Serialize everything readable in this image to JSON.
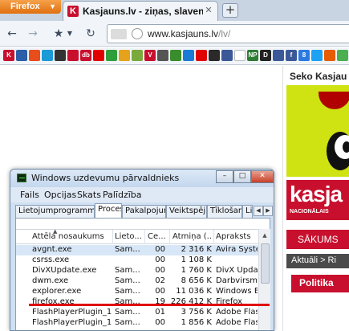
{
  "browser": {
    "menu_button": "Firefox",
    "tab": {
      "title": "Kasjauns.lv - ziņas, slavenības, sports, i...",
      "favicon_letter": "K"
    },
    "new_tab": "+",
    "url": {
      "domain": "www.kasjauns.lv",
      "path": "/lv/"
    }
  },
  "bookmarks": [
    {
      "label": "K",
      "color": "#c8102e"
    },
    {
      "label": "",
      "color": "#2b5fa8"
    },
    {
      "label": "",
      "color": "#e84d1c"
    },
    {
      "label": "",
      "color": "#1a9ad6"
    },
    {
      "label": "",
      "color": "#333333"
    },
    {
      "label": "",
      "color": "#c8102e"
    },
    {
      "label": "db",
      "color": "#c8102e"
    },
    {
      "label": "",
      "color": "#e00000"
    },
    {
      "label": "",
      "color": "#2e9e3a"
    },
    {
      "label": "",
      "color": "#e6a21a"
    },
    {
      "label": "",
      "color": "#7aa93c"
    },
    {
      "label": "V",
      "color": "#c8102e"
    },
    {
      "label": "",
      "color": "#555555"
    },
    {
      "label": "",
      "color": "#3a8d2c"
    },
    {
      "label": "",
      "color": "#1a7bd6"
    },
    {
      "label": "",
      "color": "#e00000"
    },
    {
      "label": "",
      "color": "#2a2a2a"
    },
    {
      "label": "",
      "color": "#3b5998"
    },
    {
      "label": "",
      "color": "#ffffff"
    },
    {
      "label": "NP",
      "color": "#2e7d32"
    },
    {
      "label": "D",
      "color": "#222222"
    },
    {
      "label": "",
      "color": "#3b5998"
    },
    {
      "label": "f",
      "color": "#3b5998"
    },
    {
      "label": "8",
      "color": "#2a7ae2"
    },
    {
      "label": "",
      "color": "#1da1f2"
    },
    {
      "label": "",
      "color": "#e65c00"
    },
    {
      "label": "",
      "color": "#4caf50"
    }
  ],
  "page": {
    "seko": "Seko Kasjau",
    "logo_text": "kasja",
    "logo_sub": "NACIONĀLAIS",
    "nav_home": "SĀKUMS",
    "nav_bar": "Aktuāli >   Ri",
    "section": "Politika"
  },
  "taskmanager": {
    "title": "Windows uzdevumu pārvaldnieks",
    "window_buttons": {
      "min": "–",
      "max": "□",
      "close": "✕"
    },
    "menu": [
      "Fails",
      "Opcijas",
      "Skats",
      "Palīdzība"
    ],
    "tabs": [
      "Lietojumprogrammas",
      "Procesi",
      "Pakalpojumi",
      "Veiktspēja",
      "Tīklošana",
      "Li"
    ],
    "active_tab": 1,
    "columns": [
      "Attēla nosaukums",
      "Lieto...",
      "Ce...",
      "Atmiņa (...",
      "Apraksts"
    ],
    "rows": [
      {
        "name": "avgnt.exe",
        "user": "Sam...",
        "cpu": "00",
        "mem": "2 316 K",
        "desc": "Avira Syste"
      },
      {
        "name": "csrss.exe",
        "user": "",
        "cpu": "00",
        "mem": "1 108 K",
        "desc": ""
      },
      {
        "name": "DivXUpdate.exe",
        "user": "Sam...",
        "cpu": "00",
        "mem": "1 760 K",
        "desc": "DivX Update"
      },
      {
        "name": "dwm.exe",
        "user": "Sam...",
        "cpu": "02",
        "mem": "8 656 K",
        "desc": "Darbvirsma"
      },
      {
        "name": "explorer.exe",
        "user": "Sam...",
        "cpu": "00",
        "mem": "11 036 K",
        "desc": "Windows E"
      },
      {
        "name": "firefox.exe",
        "user": "Sam...",
        "cpu": "19",
        "mem": "226 412 K",
        "desc": "Firefox"
      },
      {
        "name": "FlashPlayerPlugin_11...",
        "user": "Sam...",
        "cpu": "01",
        "mem": "3 756 K",
        "desc": "Adobe Flas"
      },
      {
        "name": "FlashPlayerPlugin_11...",
        "user": "Sam...",
        "cpu": "00",
        "mem": "1 856 K",
        "desc": "Adobe Flas"
      }
    ],
    "highlight_color": "#e00000"
  }
}
